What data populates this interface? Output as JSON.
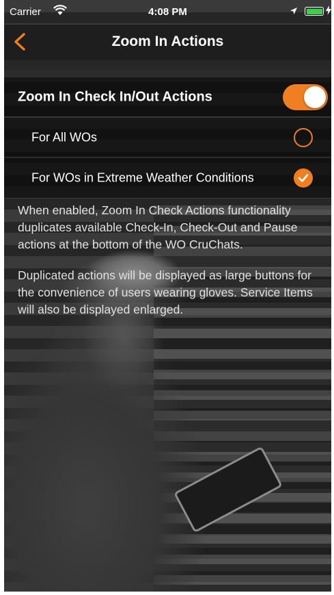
{
  "status_bar": {
    "carrier": "Carrier",
    "time": "4:08 PM",
    "wifi_icon": "wifi-icon",
    "location_icon": "location-arrow-icon",
    "battery_icon": "battery-icon",
    "battery_color": "#3ad14a"
  },
  "nav": {
    "title": "Zoom In Actions",
    "back_icon": "chevron-left-icon"
  },
  "settings": {
    "main_toggle": {
      "label": "Zoom In Check In/Out Actions",
      "on": true
    },
    "options": [
      {
        "label": "For All WOs",
        "selected": false
      },
      {
        "label": "For WOs in Extreme Weather Conditions",
        "selected": true
      }
    ]
  },
  "description": {
    "paragraph1": "When enabled, Zoom In Check Actions functionality duplicates available Check-In, Check-Out and Pause actions at the bottom of the WO CruChats.",
    "paragraph2": "Duplicated actions will be displayed as large buttons for the convenience of users wearing gloves. Service Items will also be displayed enlarged."
  },
  "colors": {
    "accent": "#f07f22",
    "nav_background": "#1e1e1e",
    "text": "#ffffff"
  }
}
